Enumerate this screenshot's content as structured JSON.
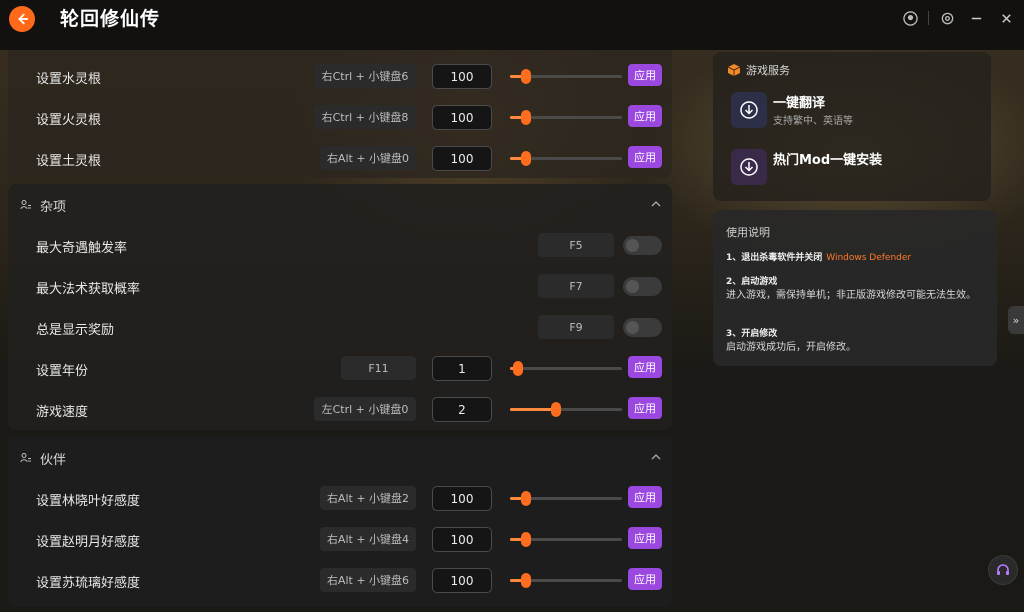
{
  "app": {
    "title": "轮回修仙传"
  },
  "colors": {
    "accent": "#ff6a1a",
    "apply": "#9a48e0",
    "link": "#ff7a2a"
  },
  "sections": {
    "top": {
      "rows": [
        {
          "label": "设置水灵根",
          "hotkey": "右Ctrl + 小键盘6",
          "value": "100",
          "slider": 0.08,
          "apply": "应用"
        },
        {
          "label": "设置火灵根",
          "hotkey": "右Ctrl + 小键盘8",
          "value": "100",
          "slider": 0.08,
          "apply": "应用"
        },
        {
          "label": "设置土灵根",
          "hotkey": "右Alt + 小键盘0",
          "value": "100",
          "slider": 0.08,
          "apply": "应用"
        }
      ]
    },
    "misc": {
      "title": "杂项",
      "rows": [
        {
          "label": "最大奇遇触发率",
          "hotkey": "F5"
        },
        {
          "label": "最大法术获取概率",
          "hotkey": "F7"
        },
        {
          "label": "总是显示奖励",
          "hotkey": "F9"
        },
        {
          "label": "设置年份",
          "hotkey": "F11",
          "value": "1",
          "slider": 0.0,
          "apply": "应用"
        },
        {
          "label": "游戏速度",
          "hotkey": "左Ctrl + 小键盘0",
          "value": "2",
          "slider": 0.39,
          "apply": "应用"
        }
      ]
    },
    "partner": {
      "title": "伙伴",
      "rows": [
        {
          "label": "设置林晓叶好感度",
          "hotkey": "右Alt + 小键盘2",
          "value": "100",
          "slider": 0.08,
          "apply": "应用"
        },
        {
          "label": "设置赵明月好感度",
          "hotkey": "右Alt + 小键盘4",
          "value": "100",
          "slider": 0.08,
          "apply": "应用"
        },
        {
          "label": "设置苏琉璃好感度",
          "hotkey": "右Alt + 小键盘6",
          "value": "100",
          "slider": 0.08,
          "apply": "应用"
        }
      ]
    }
  },
  "services": {
    "title": "游戏服务",
    "items": [
      {
        "name": "一键翻译",
        "sub": "支持繁中、英语等"
      },
      {
        "name": "热门Mod一键安装",
        "sub": ""
      }
    ]
  },
  "help": {
    "title": "使用说明",
    "steps": [
      {
        "head": "1、退出杀毒软件并关闭",
        "link": "Windows Defender",
        "body": ""
      },
      {
        "head": "2、启动游戏",
        "link": "",
        "body": "进入游戏，需保持单机；非正版游戏修改可能无法生效。"
      },
      {
        "head": "3、开启修改",
        "link": "",
        "body": "启动游戏成功后，开启修改。"
      }
    ]
  },
  "side_tab": {
    "label": "»"
  }
}
